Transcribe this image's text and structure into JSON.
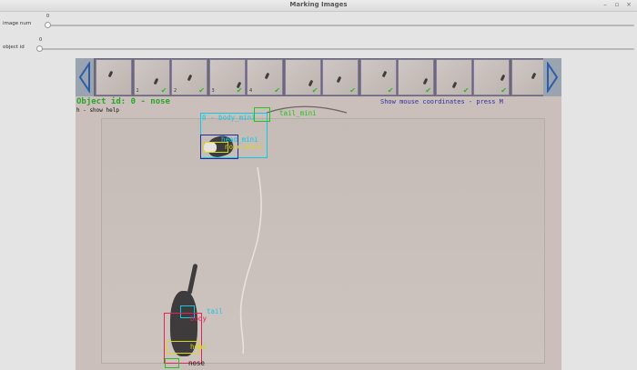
{
  "window": {
    "title": "Marking Images"
  },
  "sliders": [
    {
      "id": "image-num",
      "label": "image num",
      "value": "0",
      "position": 0
    },
    {
      "id": "object-id",
      "label": "object id",
      "value": "0",
      "position": 0
    }
  ],
  "viewer": {
    "object_header": "Object id: 0  - nose",
    "help_hint": "h - show help",
    "coords_hint": "Show mouse coordinates - press M",
    "thumbnails": [
      {
        "tag": "",
        "marked": false
      },
      {
        "tag": "1",
        "marked": true
      },
      {
        "tag": "2",
        "marked": true
      },
      {
        "tag": "3",
        "marked": true
      },
      {
        "tag": "4",
        "marked": true
      },
      {
        "tag": "",
        "marked": true
      },
      {
        "tag": "",
        "marked": true
      },
      {
        "tag": "",
        "marked": true
      },
      {
        "tag": "",
        "marked": true
      },
      {
        "tag": "",
        "marked": true
      },
      {
        "tag": "",
        "marked": true
      },
      {
        "tag": "",
        "marked": false
      }
    ],
    "annotations_top": {
      "body": "0 - body_mini",
      "tail": "tail_mini",
      "head": "head_mini",
      "nose": "nose_mini"
    },
    "annotations_bottom": {
      "tail": "tail",
      "body": "body",
      "head": "head",
      "nose": "nose"
    }
  },
  "colors": {
    "cyan": "#13c8e0",
    "green": "#22c41e",
    "navy": "#232a9c",
    "yellow": "#d8d81c",
    "pink": "#e0245a",
    "header_green": "#27a627"
  },
  "icons": [
    "chevron-left-icon",
    "chevron-right-icon",
    "checkmark-icon"
  ]
}
